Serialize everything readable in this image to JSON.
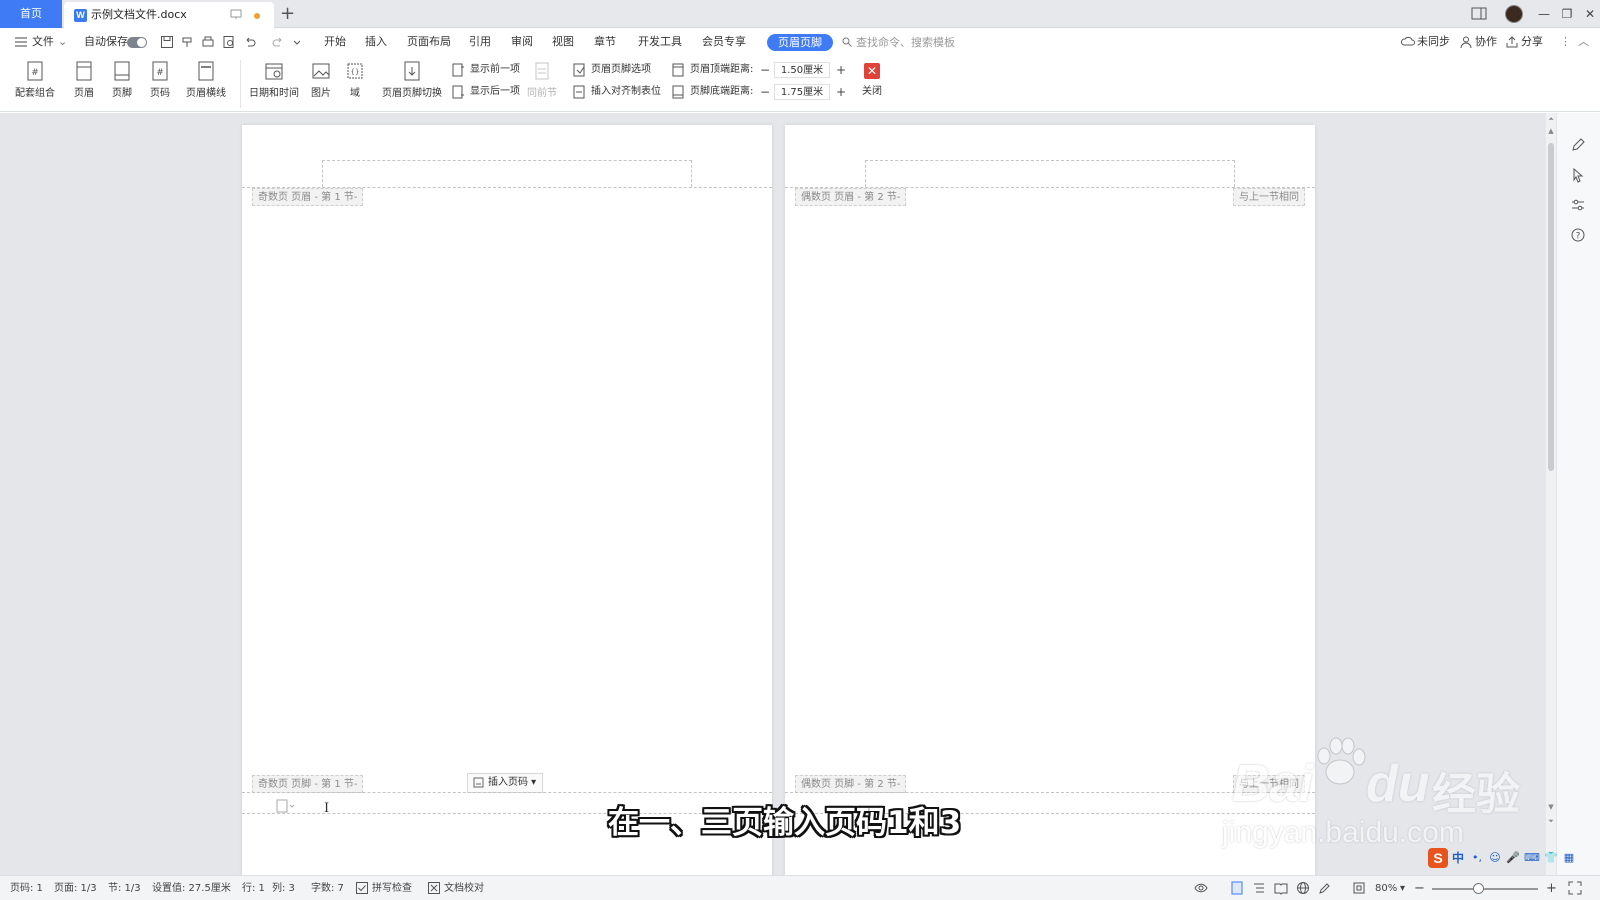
{
  "titlebar": {
    "home_tab": "首页",
    "doc_icon_letter": "W",
    "doc_tab": "示例文档文件.docx",
    "add_tab": "+",
    "window_buttons": [
      "—",
      "❐",
      "✕"
    ]
  },
  "menu": {
    "file": "文件",
    "autosave": "自动保存",
    "tabs": [
      "开始",
      "插入",
      "页面布局",
      "引用",
      "审阅",
      "视图",
      "章节",
      "开发工具",
      "会员专享"
    ],
    "active_tab": "页眉页脚",
    "search_placeholder": "查找命令、搜索模板",
    "right": {
      "sync": "未同步",
      "collab": "协作",
      "share": "分享"
    }
  },
  "ribbon": {
    "buttons": {
      "combo": "配套组合",
      "header": "页眉",
      "footer": "页脚",
      "page_number": "页码",
      "header_line": "页眉横线",
      "datetime": "日期和时间",
      "picture": "图片",
      "field": "域",
      "switch": "页眉页脚切换",
      "close": "关闭"
    },
    "nav": {
      "show_prev": "显示前一项",
      "show_next": "显示后一项",
      "same_as_prev": "同前节"
    },
    "options": {
      "hf_options": "页眉页脚选项",
      "insert_tab": "插入对齐制表位"
    },
    "distance": {
      "header_label": "页眉顶端距离:",
      "header_value": "1.50厘米",
      "footer_label": "页脚底端距离:",
      "footer_value": "1.75厘米"
    }
  },
  "pages": {
    "left": {
      "header_label": "奇数页 页眉 - 第 1 节-",
      "footer_label": "奇数页 页脚 - 第 1 节-"
    },
    "right": {
      "header_label": "偶数页 页眉 - 第 2 节-",
      "same_label": "与上一节相同",
      "footer_label": "偶数页 页脚 - 第 2 节-",
      "footer_same_label": "与上一节相同"
    },
    "insert_page_number": "插入页码",
    "cursor_glyph": "I"
  },
  "caption": "在一、三页输入页码1和3",
  "watermark": {
    "bai": "Bai",
    "du": "du",
    "jingyan": "经验",
    "url": "jingyan.baidu.com"
  },
  "ime": {
    "logo": "S",
    "lang": "中",
    "symbols": [
      "•,",
      "☺",
      "🎤",
      "⌨",
      "👕",
      "▦"
    ]
  },
  "status": {
    "page_num": "页码: 1",
    "pages": "页面: 1/3",
    "section": "节: 1/3",
    "setting": "设置值: 27.5厘米",
    "row": "行: 1",
    "col": "列: 3",
    "word_count": "字数: 7",
    "spellcheck": "拼写检查",
    "doc_check": "文档校对",
    "zoom": "80%"
  },
  "colors": {
    "accent": "#3e7bf4",
    "close_red": "#e0433a",
    "workspace_bg": "#e4e6ea"
  }
}
